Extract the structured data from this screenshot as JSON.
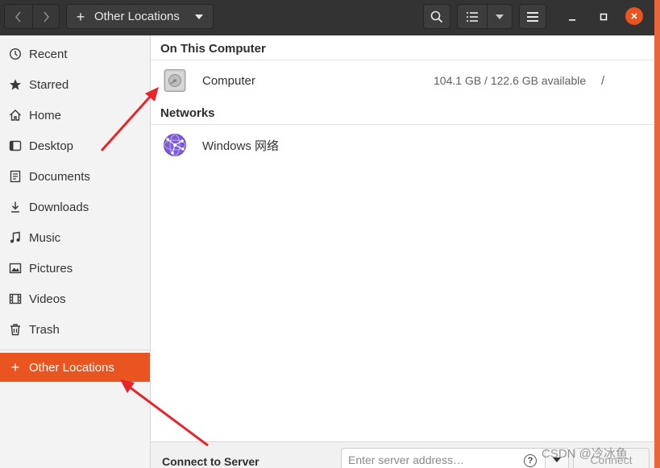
{
  "headerbar": {
    "location": "Other Locations"
  },
  "sidebar": {
    "items": [
      {
        "label": "Recent",
        "icon": "clock-icon"
      },
      {
        "label": "Starred",
        "icon": "star-icon"
      },
      {
        "label": "Home",
        "icon": "home-icon"
      },
      {
        "label": "Desktop",
        "icon": "desktop-icon"
      },
      {
        "label": "Documents",
        "icon": "document-icon"
      },
      {
        "label": "Downloads",
        "icon": "download-icon"
      },
      {
        "label": "Music",
        "icon": "music-icon"
      },
      {
        "label": "Pictures",
        "icon": "picture-icon"
      },
      {
        "label": "Videos",
        "icon": "video-icon"
      },
      {
        "label": "Trash",
        "icon": "trash-icon"
      }
    ],
    "other_locations": "Other Locations"
  },
  "main": {
    "on_this_computer": "On This Computer",
    "computer": {
      "name": "Computer",
      "space": "104.1 GB / 122.6 GB available",
      "path": "/"
    },
    "networks": "Networks",
    "windows_network": {
      "name": "Windows 网络"
    }
  },
  "connect": {
    "label": "Connect to Server",
    "placeholder": "Enter server address…",
    "button": "Connect"
  },
  "watermark": "CSDN @冷冰鱼",
  "colors": {
    "accent": "#e95420",
    "headerbar": "#333333",
    "annotation_arrow": "#e8252b"
  }
}
